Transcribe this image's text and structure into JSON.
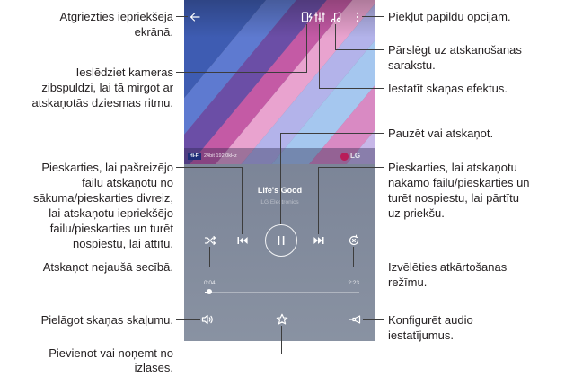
{
  "player": {
    "top_bar": {
      "back": "back-arrow-icon",
      "flash": "camera-flash-icon",
      "equalizer": "equalizer-icon",
      "playlist": "playlist-icon",
      "more": "more-options-icon"
    },
    "album_band": {
      "badge": "Hi-Fi",
      "quality": "24bit 192.0kHz",
      "logo": "LG"
    },
    "track": {
      "title": "Life's Good",
      "artist": "LG Electronics"
    },
    "controls": {
      "shuffle": "shuffle-icon",
      "previous": "skip-previous-icon",
      "play_pause": "pause-icon",
      "next": "skip-next-icon",
      "repeat": "repeat-icon"
    },
    "progress": {
      "elapsed": "0:04",
      "duration": "2:23",
      "fraction": 0.028
    },
    "bottom_bar": {
      "volume": "volume-icon",
      "favorite": "star-icon",
      "audio_settings": "audio-settings-icon"
    }
  },
  "callouts": {
    "back": [
      "Atgriezties iepriekšējā",
      "ekrānā."
    ],
    "camera_flash": [
      "Ieslēdziet kameras",
      "zibspuldzi, lai tā mirgot ar",
      "atskaņotās dziesmas ritmu."
    ],
    "previous": [
      "Pieskarties, lai pašreizējo",
      "failu atskaņotu no",
      "sākuma/pieskarties divreiz,",
      "lai atskaņotu iepriekšējo",
      "failu/pieskarties un turēt",
      "nospiestu, lai attītu."
    ],
    "shuffle": [
      "Atskaņot nejaušā secībā."
    ],
    "volume": [
      "Pielāgot skaņas skaļumu."
    ],
    "favorite": [
      "Pievienot vai noņemt no",
      "izlases."
    ],
    "more": [
      "Piekļūt papildu opcijām."
    ],
    "playlist": [
      "Pārslēgt uz atskaņošanas",
      "sarakstu."
    ],
    "equalizer": [
      "Iestatīt skaņas efektus."
    ],
    "play_pause": [
      "Pauzēt vai atskaņot."
    ],
    "next": [
      "Pieskarties, lai atskaņotu",
      "nākamo failu/pieskarties un",
      "turēt nospiestu, lai pārtītu",
      "uz priekšu."
    ],
    "repeat": [
      "Izvēlēties atkārtošanas",
      "režīmu."
    ],
    "audio_settings": [
      "Konfigurēt audio",
      "iestatījumus."
    ]
  },
  "colors": {
    "callout_text": "#231f20",
    "callout_line": "#3d3d3d"
  }
}
